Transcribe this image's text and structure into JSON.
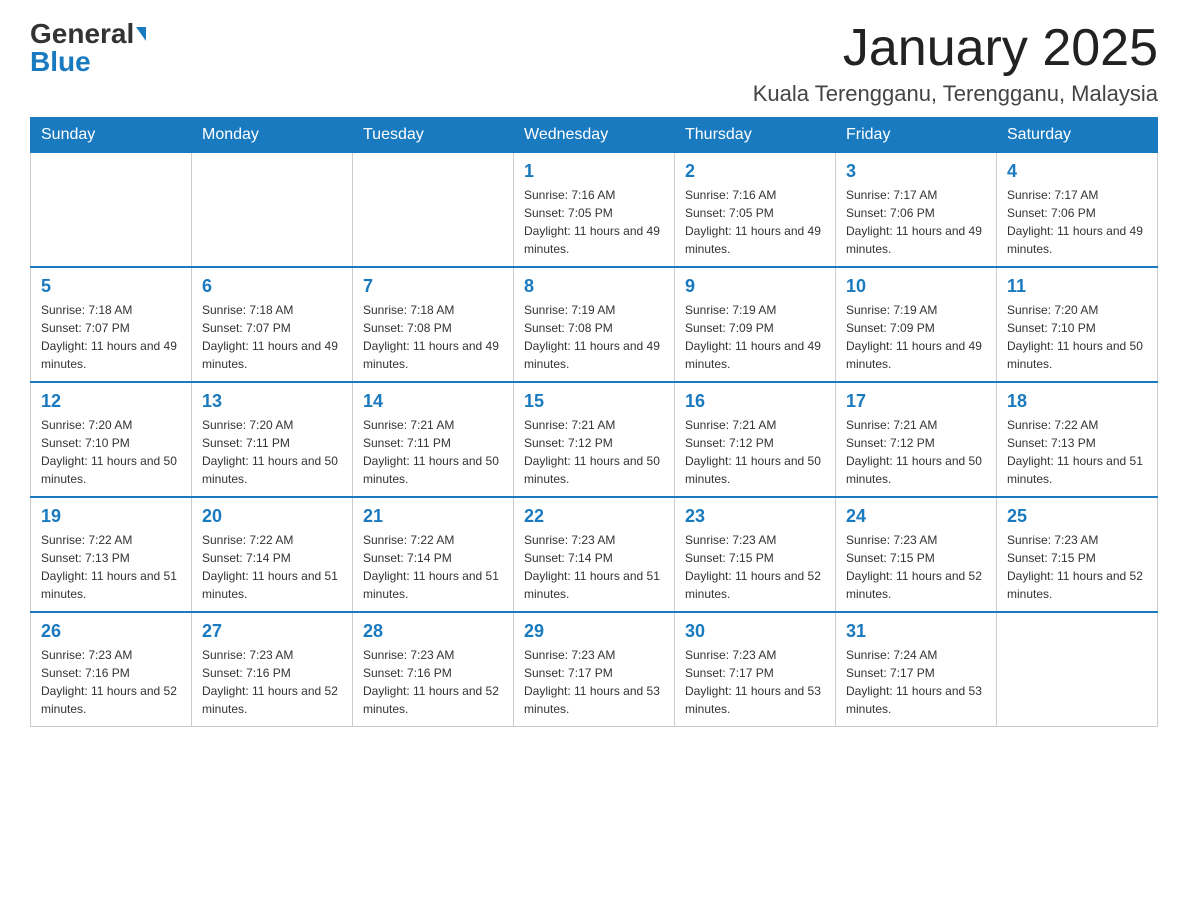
{
  "header": {
    "logo_general": "General",
    "logo_blue": "Blue",
    "month_title": "January 2025",
    "location": "Kuala Terengganu, Terengganu, Malaysia"
  },
  "days_of_week": [
    "Sunday",
    "Monday",
    "Tuesday",
    "Wednesday",
    "Thursday",
    "Friday",
    "Saturday"
  ],
  "weeks": [
    {
      "days": [
        {
          "number": "",
          "sunrise": "",
          "sunset": "",
          "daylight": ""
        },
        {
          "number": "",
          "sunrise": "",
          "sunset": "",
          "daylight": ""
        },
        {
          "number": "",
          "sunrise": "",
          "sunset": "",
          "daylight": ""
        },
        {
          "number": "1",
          "sunrise": "Sunrise: 7:16 AM",
          "sunset": "Sunset: 7:05 PM",
          "daylight": "Daylight: 11 hours and 49 minutes."
        },
        {
          "number": "2",
          "sunrise": "Sunrise: 7:16 AM",
          "sunset": "Sunset: 7:05 PM",
          "daylight": "Daylight: 11 hours and 49 minutes."
        },
        {
          "number": "3",
          "sunrise": "Sunrise: 7:17 AM",
          "sunset": "Sunset: 7:06 PM",
          "daylight": "Daylight: 11 hours and 49 minutes."
        },
        {
          "number": "4",
          "sunrise": "Sunrise: 7:17 AM",
          "sunset": "Sunset: 7:06 PM",
          "daylight": "Daylight: 11 hours and 49 minutes."
        }
      ]
    },
    {
      "days": [
        {
          "number": "5",
          "sunrise": "Sunrise: 7:18 AM",
          "sunset": "Sunset: 7:07 PM",
          "daylight": "Daylight: 11 hours and 49 minutes."
        },
        {
          "number": "6",
          "sunrise": "Sunrise: 7:18 AM",
          "sunset": "Sunset: 7:07 PM",
          "daylight": "Daylight: 11 hours and 49 minutes."
        },
        {
          "number": "7",
          "sunrise": "Sunrise: 7:18 AM",
          "sunset": "Sunset: 7:08 PM",
          "daylight": "Daylight: 11 hours and 49 minutes."
        },
        {
          "number": "8",
          "sunrise": "Sunrise: 7:19 AM",
          "sunset": "Sunset: 7:08 PM",
          "daylight": "Daylight: 11 hours and 49 minutes."
        },
        {
          "number": "9",
          "sunrise": "Sunrise: 7:19 AM",
          "sunset": "Sunset: 7:09 PM",
          "daylight": "Daylight: 11 hours and 49 minutes."
        },
        {
          "number": "10",
          "sunrise": "Sunrise: 7:19 AM",
          "sunset": "Sunset: 7:09 PM",
          "daylight": "Daylight: 11 hours and 49 minutes."
        },
        {
          "number": "11",
          "sunrise": "Sunrise: 7:20 AM",
          "sunset": "Sunset: 7:10 PM",
          "daylight": "Daylight: 11 hours and 50 minutes."
        }
      ]
    },
    {
      "days": [
        {
          "number": "12",
          "sunrise": "Sunrise: 7:20 AM",
          "sunset": "Sunset: 7:10 PM",
          "daylight": "Daylight: 11 hours and 50 minutes."
        },
        {
          "number": "13",
          "sunrise": "Sunrise: 7:20 AM",
          "sunset": "Sunset: 7:11 PM",
          "daylight": "Daylight: 11 hours and 50 minutes."
        },
        {
          "number": "14",
          "sunrise": "Sunrise: 7:21 AM",
          "sunset": "Sunset: 7:11 PM",
          "daylight": "Daylight: 11 hours and 50 minutes."
        },
        {
          "number": "15",
          "sunrise": "Sunrise: 7:21 AM",
          "sunset": "Sunset: 7:12 PM",
          "daylight": "Daylight: 11 hours and 50 minutes."
        },
        {
          "number": "16",
          "sunrise": "Sunrise: 7:21 AM",
          "sunset": "Sunset: 7:12 PM",
          "daylight": "Daylight: 11 hours and 50 minutes."
        },
        {
          "number": "17",
          "sunrise": "Sunrise: 7:21 AM",
          "sunset": "Sunset: 7:12 PM",
          "daylight": "Daylight: 11 hours and 50 minutes."
        },
        {
          "number": "18",
          "sunrise": "Sunrise: 7:22 AM",
          "sunset": "Sunset: 7:13 PM",
          "daylight": "Daylight: 11 hours and 51 minutes."
        }
      ]
    },
    {
      "days": [
        {
          "number": "19",
          "sunrise": "Sunrise: 7:22 AM",
          "sunset": "Sunset: 7:13 PM",
          "daylight": "Daylight: 11 hours and 51 minutes."
        },
        {
          "number": "20",
          "sunrise": "Sunrise: 7:22 AM",
          "sunset": "Sunset: 7:14 PM",
          "daylight": "Daylight: 11 hours and 51 minutes."
        },
        {
          "number": "21",
          "sunrise": "Sunrise: 7:22 AM",
          "sunset": "Sunset: 7:14 PM",
          "daylight": "Daylight: 11 hours and 51 minutes."
        },
        {
          "number": "22",
          "sunrise": "Sunrise: 7:23 AM",
          "sunset": "Sunset: 7:14 PM",
          "daylight": "Daylight: 11 hours and 51 minutes."
        },
        {
          "number": "23",
          "sunrise": "Sunrise: 7:23 AM",
          "sunset": "Sunset: 7:15 PM",
          "daylight": "Daylight: 11 hours and 52 minutes."
        },
        {
          "number": "24",
          "sunrise": "Sunrise: 7:23 AM",
          "sunset": "Sunset: 7:15 PM",
          "daylight": "Daylight: 11 hours and 52 minutes."
        },
        {
          "number": "25",
          "sunrise": "Sunrise: 7:23 AM",
          "sunset": "Sunset: 7:15 PM",
          "daylight": "Daylight: 11 hours and 52 minutes."
        }
      ]
    },
    {
      "days": [
        {
          "number": "26",
          "sunrise": "Sunrise: 7:23 AM",
          "sunset": "Sunset: 7:16 PM",
          "daylight": "Daylight: 11 hours and 52 minutes."
        },
        {
          "number": "27",
          "sunrise": "Sunrise: 7:23 AM",
          "sunset": "Sunset: 7:16 PM",
          "daylight": "Daylight: 11 hours and 52 minutes."
        },
        {
          "number": "28",
          "sunrise": "Sunrise: 7:23 AM",
          "sunset": "Sunset: 7:16 PM",
          "daylight": "Daylight: 11 hours and 52 minutes."
        },
        {
          "number": "29",
          "sunrise": "Sunrise: 7:23 AM",
          "sunset": "Sunset: 7:17 PM",
          "daylight": "Daylight: 11 hours and 53 minutes."
        },
        {
          "number": "30",
          "sunrise": "Sunrise: 7:23 AM",
          "sunset": "Sunset: 7:17 PM",
          "daylight": "Daylight: 11 hours and 53 minutes."
        },
        {
          "number": "31",
          "sunrise": "Sunrise: 7:24 AM",
          "sunset": "Sunset: 7:17 PM",
          "daylight": "Daylight: 11 hours and 53 minutes."
        },
        {
          "number": "",
          "sunrise": "",
          "sunset": "",
          "daylight": ""
        }
      ]
    }
  ]
}
